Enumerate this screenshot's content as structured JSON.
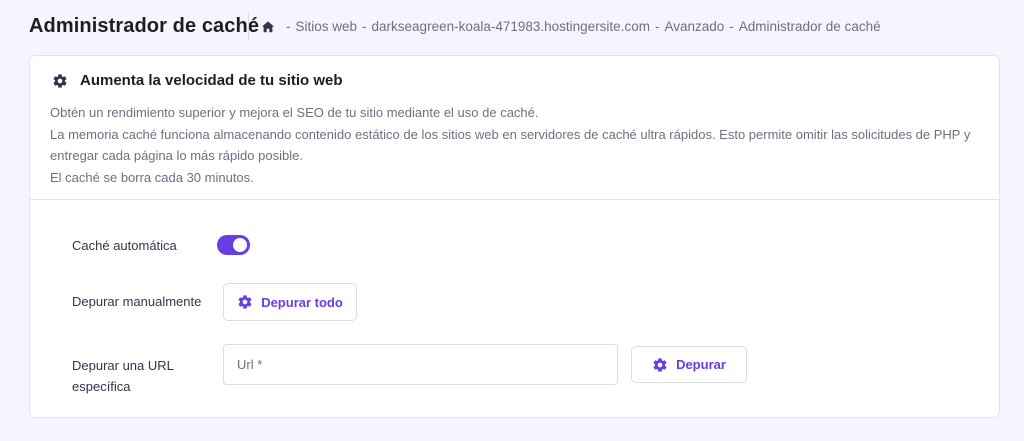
{
  "header": {
    "title": "Administrador de caché",
    "breadcrumb": [
      "Sitios web",
      "darkseagreen-koala-471983.hostingersite.com",
      "Avanzado",
      "Administrador de caché"
    ],
    "separator": "-"
  },
  "card": {
    "title": "Aumenta la velocidad de tu sitio web",
    "description": [
      "Obtén un rendimiento superior y mejora el SEO de tu sitio mediante el uso de caché.",
      "La memoria caché funciona almacenando contenido estático de los sitios web en servidores de caché ultra rápidos. Esto permite omitir las solicitudes de PHP y entregar cada página lo más rápido posible.",
      "El caché se borra cada 30 minutos."
    ],
    "auto_cache": {
      "label": "Caché automática",
      "enabled": true
    },
    "purge_manual": {
      "label": "Depurar manualmente",
      "button": "Depurar todo"
    },
    "purge_url": {
      "label_line1": "Depurar una URL",
      "label_line2": "específica",
      "placeholder": "Url *",
      "value": "",
      "button": "Depurar"
    }
  },
  "colors": {
    "accent": "#673de6",
    "background": "#f4f5ff",
    "text": "#36344d",
    "muted": "#6d7081"
  }
}
